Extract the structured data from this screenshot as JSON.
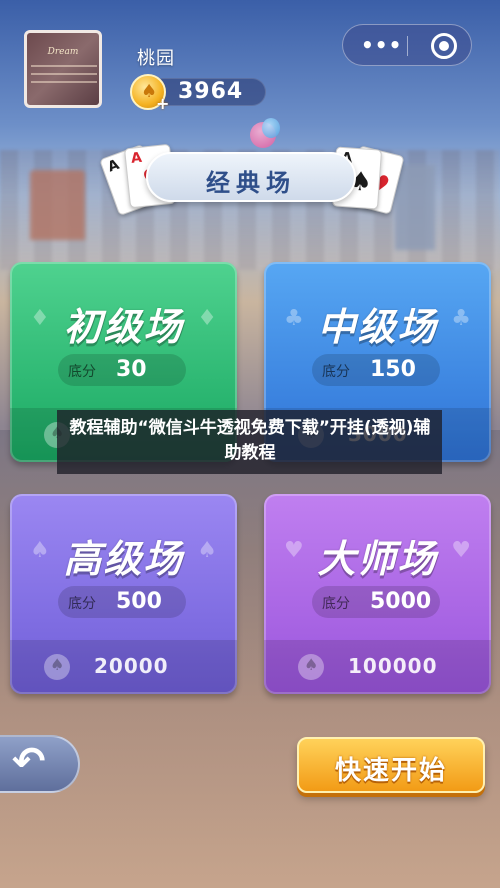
{
  "header": {
    "username": "桃园",
    "coins": "3964",
    "avatar_title": "Dream"
  },
  "banner": {
    "title": "经典场"
  },
  "rooms": [
    {
      "name": "初级场",
      "base_label": "底分",
      "base_value": "30",
      "entry": ""
    },
    {
      "name": "中级场",
      "base_label": "底分",
      "base_value": "150",
      "entry": "3000"
    },
    {
      "name": "高级场",
      "base_label": "底分",
      "base_value": "500",
      "entry": "20000"
    },
    {
      "name": "大师场",
      "base_label": "底分",
      "base_value": "5000",
      "entry": "100000"
    }
  ],
  "caption": {
    "text": "教程辅助“微信斗牛透视免费下载”开挂(透视)辅助教程"
  },
  "buttons": {
    "quick_start": "快速开始"
  },
  "colors": {
    "green_room": "#19a862",
    "blue_room": "#2e72d6",
    "purple_room": "#6f5ed8",
    "violet_room": "#9a55dc",
    "start_button": "#f29b16"
  },
  "icons": [
    "spade-coin-icon",
    "more-dots-icon",
    "target-icon",
    "back-arrow-icon",
    "card-heart-icon",
    "card-spade-icon"
  ]
}
